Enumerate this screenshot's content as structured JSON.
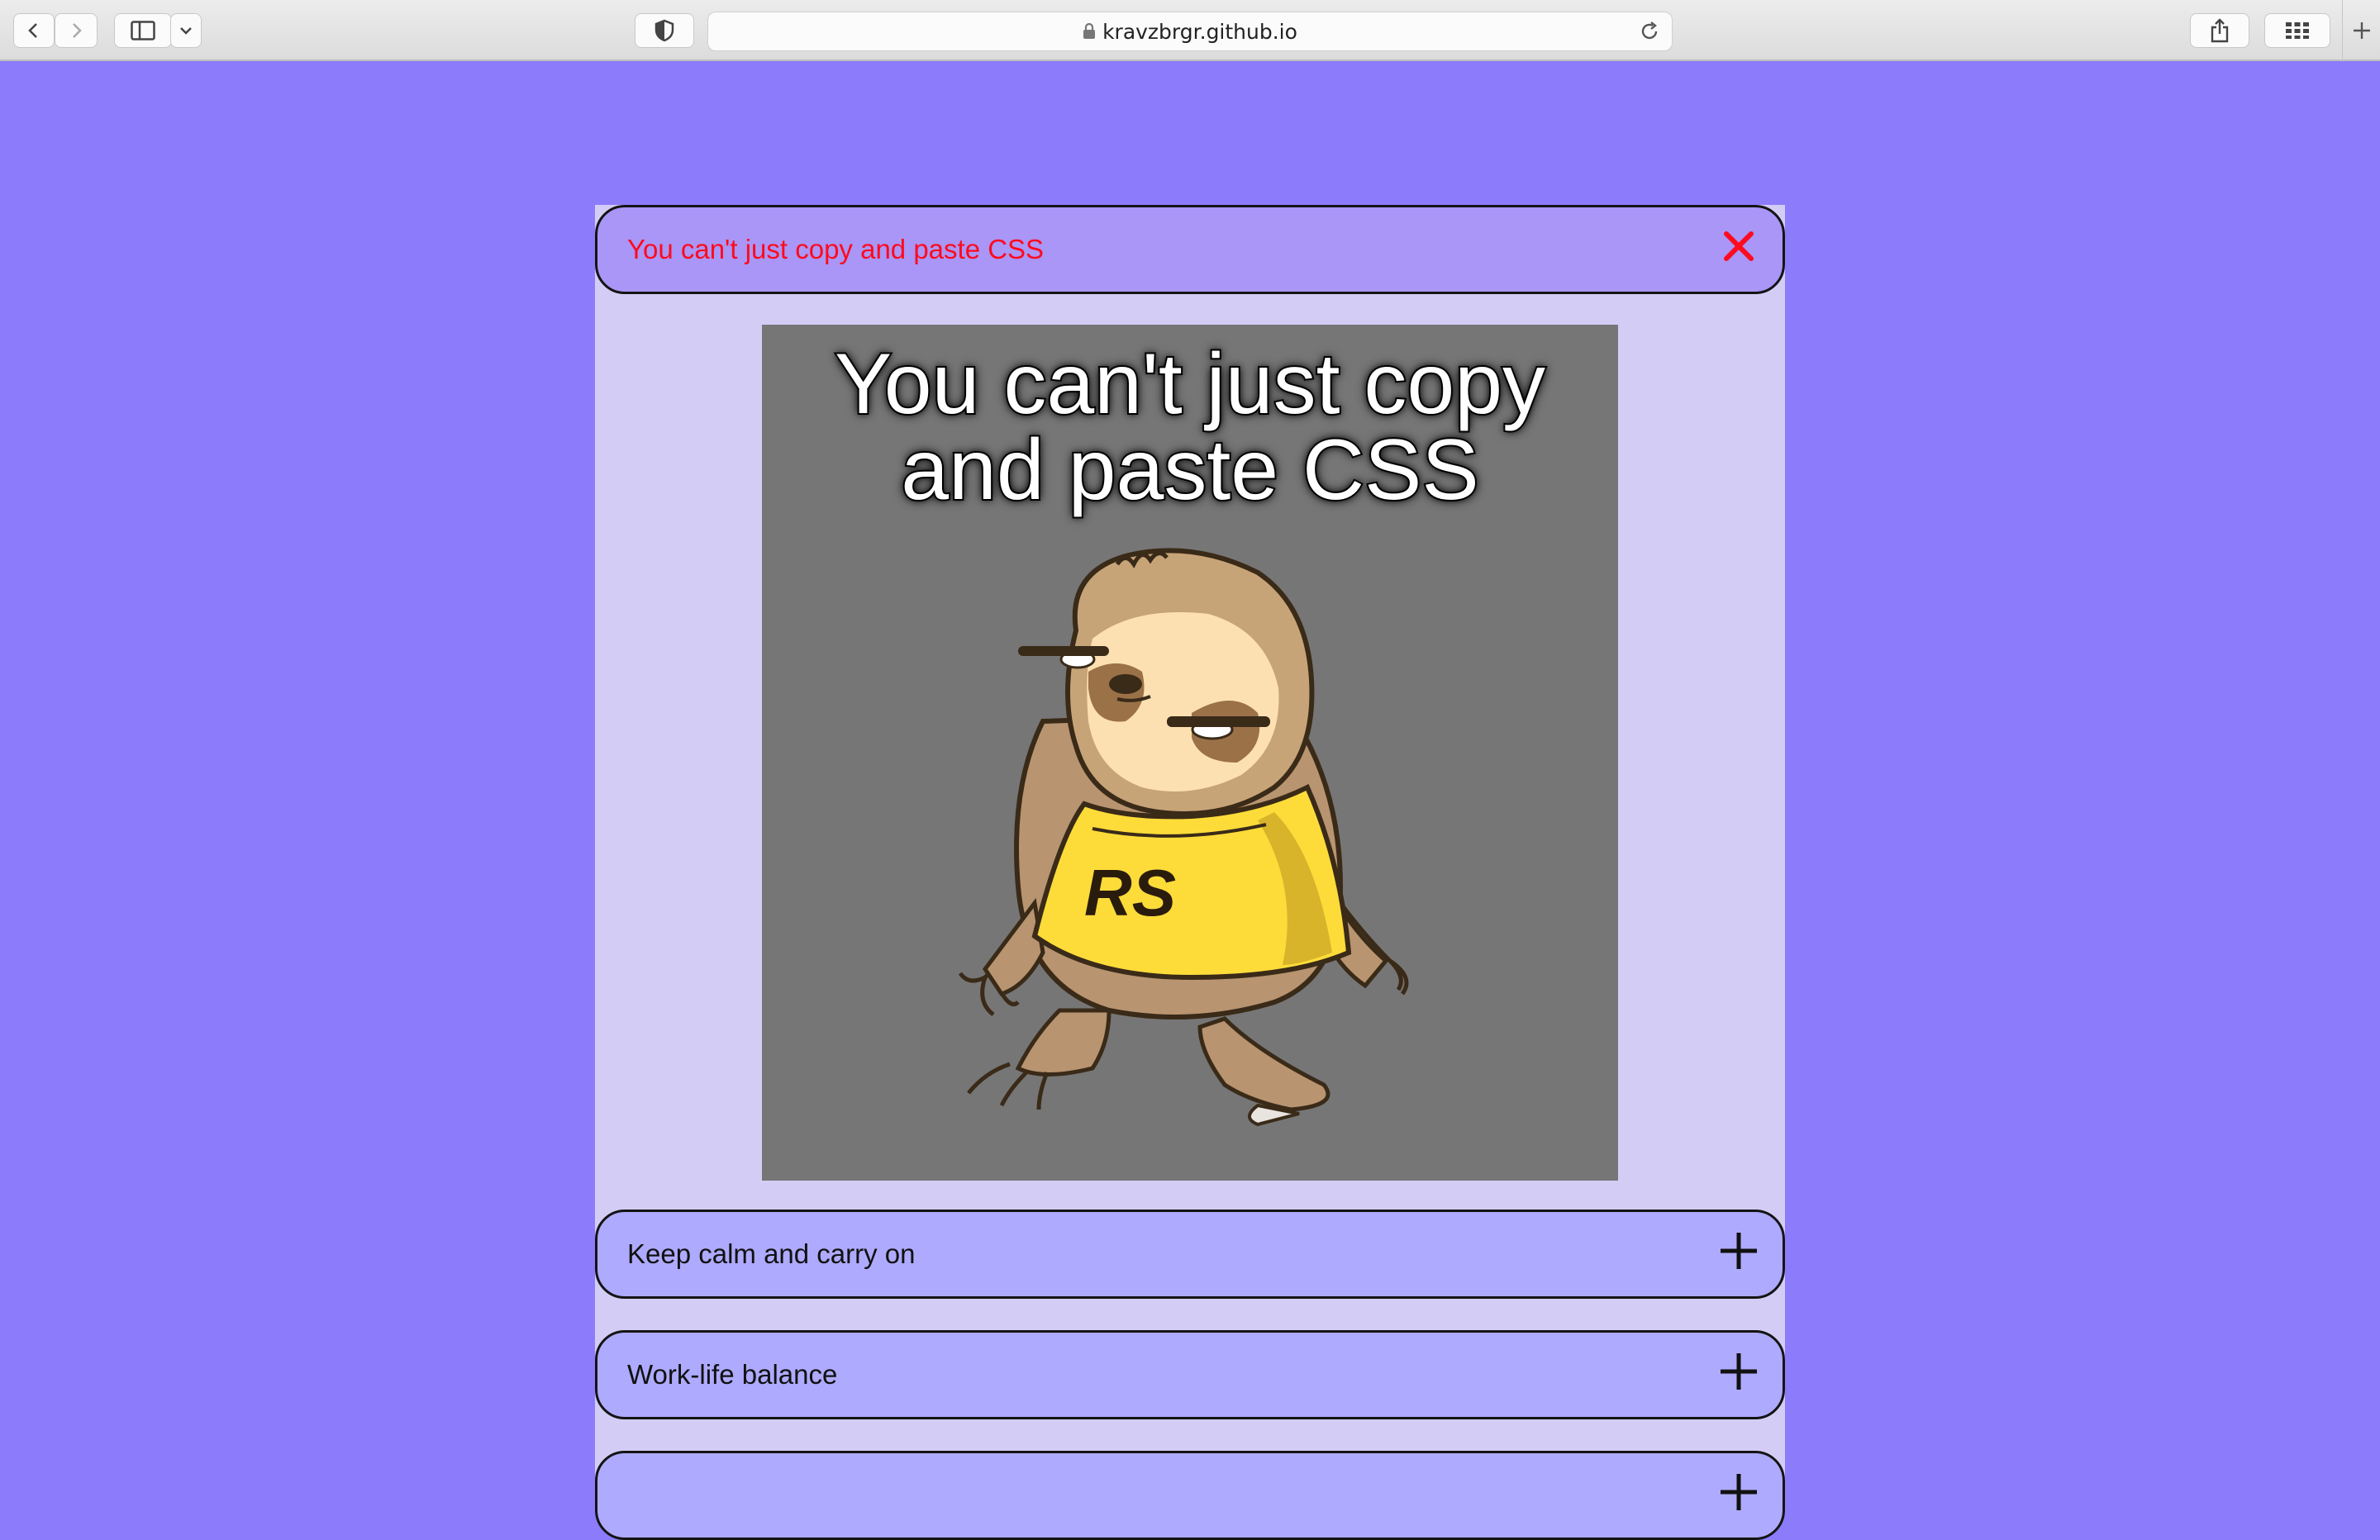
{
  "browser": {
    "url": "kravzbrgr.github.io"
  },
  "accordion": {
    "items": [
      {
        "title": "You can't just copy and paste CSS",
        "open": true,
        "image": {
          "caption": "You can't just copy and paste CSS",
          "shirt_text": "RS"
        }
      },
      {
        "title": "Keep calm and carry on",
        "open": false
      },
      {
        "title": "Work-life balance",
        "open": false
      },
      {
        "title": "",
        "open": false
      }
    ]
  },
  "colors": {
    "page_background": "#8c7cfb",
    "panel_background": "#d3cdf6",
    "open_item_title": "#ff0a1e",
    "close_icon": "#ff0a1e",
    "item_background": "#aeaafd"
  },
  "icons": {
    "open_item": "close-icon",
    "closed_item": "plus-icon"
  }
}
